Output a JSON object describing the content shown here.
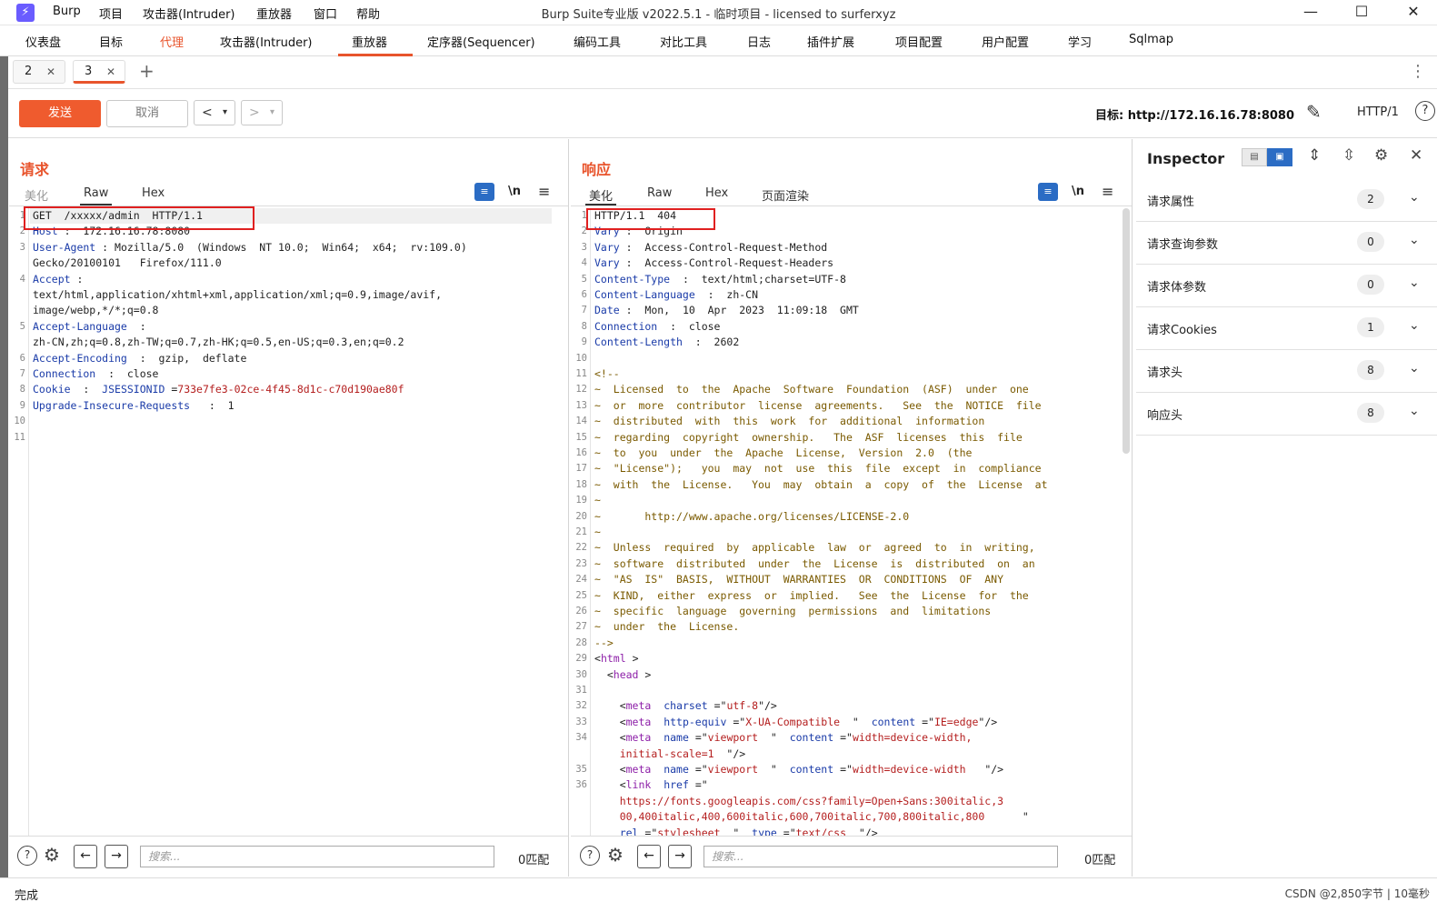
{
  "window": {
    "app_name": "Burp",
    "title": "Burp Suite专业版  v2022.5.1 - 临时项目 - licensed to surferxyz",
    "menu": [
      "项目",
      "攻击器(Intruder)",
      "重放器",
      "窗口",
      "帮助"
    ],
    "minimize": "—",
    "maximize": "☐",
    "close": "✕"
  },
  "main_tabs": [
    "仪表盘",
    "目标",
    "代理",
    "攻击器(Intruder)",
    "重放器",
    "定序器(Sequencer)",
    "编码工具",
    "对比工具",
    "日志",
    "插件扩展",
    "项目配置",
    "用户配置",
    "学习",
    "Sqlmap"
  ],
  "sub_tabs": [
    {
      "label": "2"
    },
    {
      "label": "3"
    }
  ],
  "toolbar": {
    "send": "发送",
    "cancel": "取消",
    "target": "目标: http://172.16.16.78:8080",
    "protocol": "HTTP/1"
  },
  "request": {
    "title": "请求",
    "views": [
      "美化",
      "Raw",
      "Hex"
    ],
    "lines": [
      {
        "n": "1",
        "segs": [
          [
            "GET  /xxxxx/admin  HTTP/1.1",
            "plain"
          ]
        ]
      },
      {
        "n": "2",
        "segs": [
          [
            "Host",
            "key"
          ],
          [
            " :  172.16.16.78:8080",
            "plain"
          ]
        ]
      },
      {
        "n": "3",
        "segs": [
          [
            "User-Agent",
            "key"
          ],
          [
            " : Mozilla/5.0  (Windows  NT 10.0;  Win64;  x64;  rv:109.0)",
            "plain"
          ]
        ]
      },
      {
        "n": "",
        "segs": [
          [
            "Gecko/20100101   Firefox/111.0",
            "plain"
          ]
        ]
      },
      {
        "n": "4",
        "segs": [
          [
            "Accept",
            "key"
          ],
          [
            " :",
            "plain"
          ]
        ]
      },
      {
        "n": "",
        "segs": [
          [
            "text/html,application/xhtml+xml,application/xml;q=0.9,image/avif,",
            "plain"
          ]
        ]
      },
      {
        "n": "",
        "segs": [
          [
            "image/webp,*/*;q=0.8",
            "plain"
          ]
        ]
      },
      {
        "n": "5",
        "segs": [
          [
            "Accept-Language",
            "key"
          ],
          [
            "  :",
            "plain"
          ]
        ]
      },
      {
        "n": "",
        "segs": [
          [
            "zh-CN,zh;q=0.8,zh-TW;q=0.7,zh-HK;q=0.5,en-US;q=0.3,en;q=0.2",
            "plain"
          ]
        ]
      },
      {
        "n": "6",
        "segs": [
          [
            "Accept-Encoding",
            "key"
          ],
          [
            "  :  gzip,  deflate",
            "plain"
          ]
        ]
      },
      {
        "n": "7",
        "segs": [
          [
            "Connection",
            "key"
          ],
          [
            "  :  close",
            "plain"
          ]
        ]
      },
      {
        "n": "8",
        "segs": [
          [
            "Cookie",
            "key"
          ],
          [
            "  :  ",
            "plain"
          ],
          [
            "JSESSIONID",
            "key"
          ],
          [
            " =",
            "plain"
          ],
          [
            "733e7fe3-02ce-4f45-8d1c-c70d190ae80f",
            "red"
          ]
        ]
      },
      {
        "n": "9",
        "segs": [
          [
            "Upgrade-Insecure-Requests",
            "key"
          ],
          [
            "   :  1",
            "plain"
          ]
        ]
      },
      {
        "n": "10",
        "segs": []
      },
      {
        "n": "11",
        "segs": []
      }
    ],
    "search_placeholder": "搜索...",
    "matches": "0匹配"
  },
  "response": {
    "title": "响应",
    "views": [
      "美化",
      "Raw",
      "Hex",
      "页面渲染"
    ],
    "lines": [
      {
        "n": "1",
        "segs": [
          [
            "HTTP/1.1  404",
            "plain"
          ]
        ]
      },
      {
        "n": "2",
        "segs": [
          [
            "Vary",
            "key"
          ],
          [
            " :  Origin",
            "plain"
          ]
        ]
      },
      {
        "n": "3",
        "segs": [
          [
            "Vary",
            "key"
          ],
          [
            " :  Access-Control-Request-Method",
            "plain"
          ]
        ]
      },
      {
        "n": "4",
        "segs": [
          [
            "Vary",
            "key"
          ],
          [
            " :  Access-Control-Request-Headers",
            "plain"
          ]
        ]
      },
      {
        "n": "5",
        "segs": [
          [
            "Content-Type",
            "key"
          ],
          [
            "  :  text/html;charset=UTF-8",
            "plain"
          ]
        ]
      },
      {
        "n": "6",
        "segs": [
          [
            "Content-Language",
            "key"
          ],
          [
            "  :  zh-CN",
            "plain"
          ]
        ]
      },
      {
        "n": "7",
        "segs": [
          [
            "Date",
            "key"
          ],
          [
            " :  Mon,  10  Apr  2023  11:09:18  GMT",
            "plain"
          ]
        ]
      },
      {
        "n": "8",
        "segs": [
          [
            "Connection",
            "key"
          ],
          [
            "  :  close",
            "plain"
          ]
        ]
      },
      {
        "n": "9",
        "segs": [
          [
            "Content-Length",
            "key"
          ],
          [
            "  :  2602",
            "plain"
          ]
        ]
      },
      {
        "n": "10",
        "segs": []
      },
      {
        "n": "11",
        "segs": [
          [
            "<!--",
            "comment"
          ]
        ]
      },
      {
        "n": "12",
        "segs": [
          [
            "~  Licensed  to  the  Apache  Software  Foundation  (ASF)  under  one",
            "comment"
          ]
        ]
      },
      {
        "n": "13",
        "segs": [
          [
            "~  or  more  contributor  license  agreements.   See  the  NOTICE  file",
            "comment"
          ]
        ]
      },
      {
        "n": "14",
        "segs": [
          [
            "~  distributed  with  this  work  for  additional  information",
            "comment"
          ]
        ]
      },
      {
        "n": "15",
        "segs": [
          [
            "~  regarding  copyright  ownership.   The  ASF  licenses  this  file",
            "comment"
          ]
        ]
      },
      {
        "n": "16",
        "segs": [
          [
            "~  to  you  under  the  Apache  License,  Version  2.0  (the",
            "comment"
          ]
        ]
      },
      {
        "n": "17",
        "segs": [
          [
            "~  \"License\");   you  may  not  use  this  file  except  in  compliance",
            "comment"
          ]
        ]
      },
      {
        "n": "18",
        "segs": [
          [
            "~  with  the  License.   You  may  obtain  a  copy  of  the  License  at",
            "comment"
          ]
        ]
      },
      {
        "n": "19",
        "segs": [
          [
            "~",
            "comment"
          ]
        ]
      },
      {
        "n": "20",
        "segs": [
          [
            "~       http://www.apache.org/licenses/LICENSE-2.0",
            "comment"
          ]
        ]
      },
      {
        "n": "21",
        "segs": [
          [
            "~",
            "comment"
          ]
        ]
      },
      {
        "n": "22",
        "segs": [
          [
            "~  Unless  required  by  applicable  law  or  agreed  to  in  writing,",
            "comment"
          ]
        ]
      },
      {
        "n": "23",
        "segs": [
          [
            "~  software  distributed  under  the  License  is  distributed  on  an",
            "comment"
          ]
        ]
      },
      {
        "n": "24",
        "segs": [
          [
            "~  \"AS  IS\"  BASIS,  WITHOUT  WARRANTIES  OR  CONDITIONS  OF  ANY",
            "comment"
          ]
        ]
      },
      {
        "n": "25",
        "segs": [
          [
            "~  KIND,  either  express  or  implied.   See  the  License  for  the",
            "comment"
          ]
        ]
      },
      {
        "n": "26",
        "segs": [
          [
            "~  specific  language  governing  permissions  and  limitations",
            "comment"
          ]
        ]
      },
      {
        "n": "27",
        "segs": [
          [
            "~  under  the  License.",
            "comment"
          ]
        ]
      },
      {
        "n": "28",
        "segs": [
          [
            "-->",
            "comment"
          ]
        ]
      },
      {
        "n": "29",
        "segs": [
          [
            "<",
            "plain"
          ],
          [
            "html",
            "tag"
          ],
          [
            " >",
            "plain"
          ]
        ]
      },
      {
        "n": "30",
        "segs": [
          [
            "  <",
            "plain"
          ],
          [
            "head",
            "tag"
          ],
          [
            " >",
            "plain"
          ]
        ]
      },
      {
        "n": "31",
        "segs": []
      },
      {
        "n": "32",
        "segs": [
          [
            "    <",
            "plain"
          ],
          [
            "meta",
            "tag"
          ],
          [
            "  ",
            "plain"
          ],
          [
            "charset",
            "key"
          ],
          [
            " =\"",
            "plain"
          ],
          [
            "utf-8",
            "red"
          ],
          [
            "\"/>",
            "plain"
          ]
        ]
      },
      {
        "n": "33",
        "segs": [
          [
            "    <",
            "plain"
          ],
          [
            "meta",
            "tag"
          ],
          [
            "  ",
            "plain"
          ],
          [
            "http-equiv",
            "key"
          ],
          [
            " =\"",
            "plain"
          ],
          [
            "X-UA-Compatible",
            "red"
          ],
          [
            "  \"  ",
            "plain"
          ],
          [
            "content",
            "key"
          ],
          [
            " =\"",
            "plain"
          ],
          [
            "IE=edge",
            "red"
          ],
          [
            "\"/>",
            "plain"
          ]
        ]
      },
      {
        "n": "34",
        "segs": [
          [
            "    <",
            "plain"
          ],
          [
            "meta",
            "tag"
          ],
          [
            "  ",
            "plain"
          ],
          [
            "name",
            "key"
          ],
          [
            " =\"",
            "plain"
          ],
          [
            "viewport",
            "red"
          ],
          [
            "  \"  ",
            "plain"
          ],
          [
            "content",
            "key"
          ],
          [
            " =\"",
            "plain"
          ],
          [
            "width=device-width,",
            "red"
          ]
        ]
      },
      {
        "n": "",
        "segs": [
          [
            "    ",
            "plain"
          ],
          [
            "initial-scale=1",
            "red"
          ],
          [
            "  \"/>",
            "plain"
          ]
        ]
      },
      {
        "n": "35",
        "segs": [
          [
            "    <",
            "plain"
          ],
          [
            "meta",
            "tag"
          ],
          [
            "  ",
            "plain"
          ],
          [
            "name",
            "key"
          ],
          [
            " =\"",
            "plain"
          ],
          [
            "viewport",
            "red"
          ],
          [
            "  \"  ",
            "plain"
          ],
          [
            "content",
            "key"
          ],
          [
            " =\"",
            "plain"
          ],
          [
            "width=device-width",
            "red"
          ],
          [
            "   \"/>",
            "plain"
          ]
        ]
      },
      {
        "n": "36",
        "segs": [
          [
            "    <",
            "plain"
          ],
          [
            "link",
            "tag"
          ],
          [
            "  ",
            "plain"
          ],
          [
            "href",
            "key"
          ],
          [
            " =\"",
            "plain"
          ]
        ]
      },
      {
        "n": "",
        "segs": [
          [
            "    ",
            "plain"
          ],
          [
            "https://fonts.googleapis.com/css?family=Open+Sans:300italic,3",
            "red"
          ]
        ]
      },
      {
        "n": "",
        "segs": [
          [
            "    ",
            "plain"
          ],
          [
            "00,400italic,400,600italic,600,700italic,700,800italic,800",
            "red"
          ],
          [
            "      \"",
            "plain"
          ]
        ]
      },
      {
        "n": "",
        "segs": [
          [
            "    ",
            "plain"
          ],
          [
            "rel",
            "key"
          ],
          [
            " =\"",
            "plain"
          ],
          [
            "stylesheet",
            "red"
          ],
          [
            "  \"  ",
            "plain"
          ],
          [
            "type",
            "key"
          ],
          [
            " =\"",
            "plain"
          ],
          [
            "text/css",
            "red"
          ],
          [
            "  \"/>",
            "plain"
          ]
        ]
      }
    ],
    "search_placeholder": "搜索...",
    "matches": "0匹配"
  },
  "inspector": {
    "title": "Inspector",
    "rows": [
      {
        "label": "请求属性",
        "count": "2"
      },
      {
        "label": "请求查询参数",
        "count": "0"
      },
      {
        "label": "请求体参数",
        "count": "0"
      },
      {
        "label": "请求Cookies",
        "count": "1"
      },
      {
        "label": "请求头",
        "count": "8"
      },
      {
        "label": "响应头",
        "count": "8"
      }
    ]
  },
  "status": {
    "left": "完成",
    "right": "CSDN @2,850字节 | 10毫秒"
  },
  "colors": {
    "accent": "#e8542c",
    "send_button": "#ef5b2e",
    "toggle_blue": "#2b6cc4",
    "highlight_box": "#e02020",
    "header_key": "#1a3ba8",
    "string_value": "#b41e1e",
    "tag_name": "#8d1fa8",
    "comment": "#7a5a00"
  }
}
